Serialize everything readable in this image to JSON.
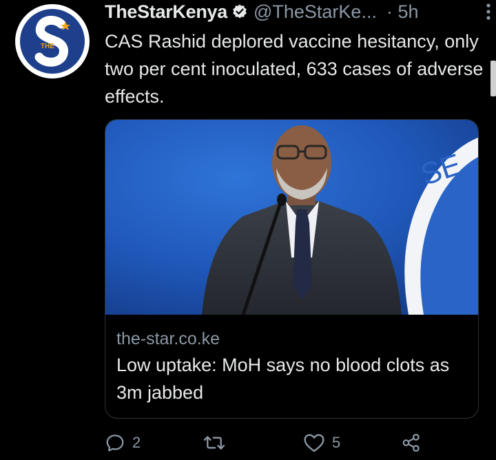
{
  "tweet": {
    "display_name": "TheStarKenya",
    "handle": "@TheStarKe...",
    "time": "· 5h",
    "avatar_text": "THE",
    "text": "CAS Rashid deplored vaccine hesitancy, only two per cent inoculated, 633 cases of adverse effects.",
    "card": {
      "banner_text": "SE",
      "domain": "the-star.co.ke",
      "title": "Low uptake: MoH says no blood clots as 3m jabbed"
    },
    "actions": {
      "reply_count": "2",
      "retweet_count": "",
      "like_count": "5"
    }
  },
  "colors": {
    "background": "#000000",
    "text": "#e7e9ea",
    "secondary_text": "#8b98a5",
    "avatar_blue": "#1d3f8c",
    "verified_badge": "#e7e9ea"
  },
  "icons": [
    "verified-badge-icon",
    "more-options-icon",
    "reply-icon",
    "retweet-icon",
    "like-icon",
    "share-icon"
  ]
}
